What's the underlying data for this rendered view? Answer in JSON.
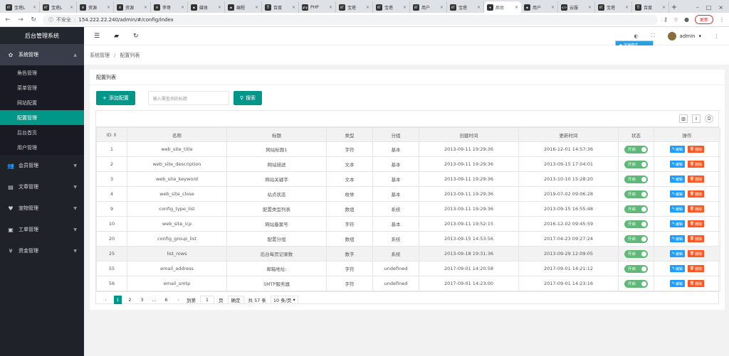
{
  "browser": {
    "tabs": [
      {
        "fav": "BT",
        "label": "宝塔L"
      },
      {
        "fav": "BT",
        "label": "宝塔L"
      },
      {
        "fav": "W",
        "label": "资源"
      },
      {
        "fav": "W",
        "label": "资源"
      },
      {
        "fav": "W",
        "label": "李哥"
      },
      {
        "fav": "●",
        "label": "媒体"
      },
      {
        "fav": "●",
        "label": "编程"
      },
      {
        "fav": "百",
        "label": "百度"
      },
      {
        "fav": "php",
        "label": "PHP"
      },
      {
        "fav": "BT",
        "label": "宝塔"
      },
      {
        "fav": "BT",
        "label": "宝塔"
      },
      {
        "fav": "BT",
        "label": "用户"
      },
      {
        "fav": "BT",
        "label": "宝塔"
      },
      {
        "fav": "▼",
        "label": "后台"
      },
      {
        "fav": "●",
        "label": "用户"
      },
      {
        "fav": "</>",
        "label": "云服"
      },
      {
        "fav": "BT",
        "label": "宝塔"
      },
      {
        "fav": "百",
        "label": "百度"
      }
    ],
    "active_tab": 13,
    "new_tab": "+",
    "secure_label": "不安全",
    "url": "154.222.22.240/admin/#/config/index",
    "update_label": "更新"
  },
  "sidebar": {
    "title": "后台管理系统",
    "groups": [
      {
        "icon": "✿",
        "label": "系统管理",
        "open": true,
        "items": [
          {
            "label": "角色管理",
            "active": false
          },
          {
            "label": "菜单管理",
            "active": false
          },
          {
            "label": "网站配置",
            "active": false
          },
          {
            "label": "配置管理",
            "active": true
          },
          {
            "label": "后台首页",
            "active": false
          },
          {
            "label": "用户管理",
            "active": false
          }
        ]
      },
      {
        "icon": "👥",
        "label": "会员管理",
        "open": false
      },
      {
        "icon": "▤",
        "label": "文章管理",
        "open": false
      },
      {
        "icon": "♥",
        "label": "宠物管理",
        "open": false
      },
      {
        "icon": "▣",
        "label": "工单管理",
        "open": false
      },
      {
        "icon": "¥",
        "label": "资金管理",
        "open": false
      }
    ]
  },
  "header": {
    "user": "admin",
    "badge": "加速模式"
  },
  "breadcrumb": [
    "系统管理",
    "配置列表"
  ],
  "card": {
    "title": "配置列表",
    "add_label": "添加配置",
    "search_placeholder": "输入需查询的标题",
    "search_label": "搜索"
  },
  "table": {
    "columns": [
      "ID",
      "名称",
      "标题",
      "类型",
      "分组",
      "创建时间",
      "更新时间",
      "状态",
      "操作"
    ],
    "rows": [
      [
        "1",
        "web_site_title",
        "网站标题1",
        "字符",
        "基本",
        "2013-09-11 19:29:36",
        "2016-12-01 14:57:36"
      ],
      [
        "2",
        "web_site_description",
        "网站描述",
        "文本",
        "基本",
        "2013-09-11 19:29:36",
        "2013-09-15 17:04:01"
      ],
      [
        "3",
        "web_site_keyword",
        "网站关键字",
        "文本",
        "基本",
        "2013-09-11 19:29:36",
        "2013-10-10 15:28:20"
      ],
      [
        "4",
        "web_site_close",
        "站点状态",
        "枚举",
        "基本",
        "2013-09-11 19:29:36",
        "2019-07-02 09:06:28"
      ],
      [
        "9",
        "config_type_list",
        "配置类型列表",
        "数组",
        "系统",
        "2013-09-11 19:29:36",
        "2013-09-15 16:55:48"
      ],
      [
        "10",
        "web_site_icp",
        "网站备案号",
        "字符",
        "基本",
        "2013-09-11 19:52:15",
        "2016-12-02 09:45:59"
      ],
      [
        "20",
        "config_group_list",
        "配置分组",
        "数组",
        "系统",
        "2013-09-15 14:53:56",
        "2017-04-23 09:27:24"
      ],
      [
        "25",
        "list_rows",
        "后台每页记录数",
        "数字",
        "系统",
        "2013-09-18 19:31:36",
        "2013-09-29 12:09:05"
      ],
      [
        "55",
        "email_address",
        "邮箱地址:",
        "字符",
        "undefined",
        "2017-09-01 14:20:58",
        "2017-09-01 14:21:12"
      ],
      [
        "56",
        "email_smtp",
        "SMTP服务器",
        "字符",
        "undefined",
        "2017-09-01 14:23:00",
        "2017-09-01 14:23:16"
      ]
    ],
    "highlight_row": 7,
    "status_label": "开启",
    "edit_label": "编辑",
    "delete_label": "删除"
  },
  "pager": {
    "pages": [
      "1",
      "2",
      "3",
      "...",
      "6"
    ],
    "current": "1",
    "goto_label": "到第",
    "goto_value": "1",
    "page_unit": "页",
    "confirm_label": "确定",
    "total_label": "共 57 条",
    "size_label": "10 条/页"
  }
}
